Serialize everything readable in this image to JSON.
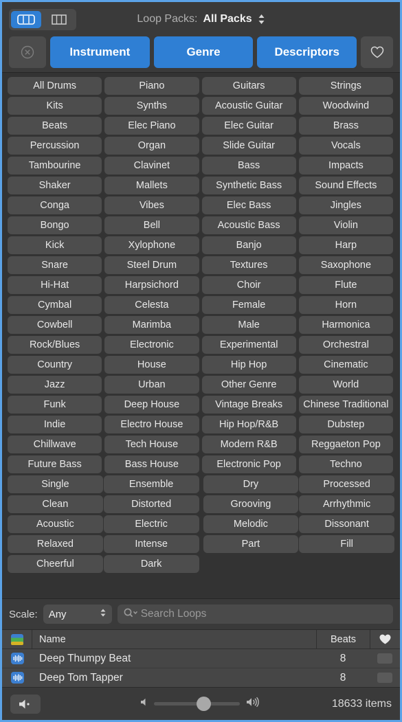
{
  "colors": {
    "accent": "#2f7fd4",
    "window_border": "#5ba3e8",
    "chrome_bg": "#3a3a3a",
    "grid_bg": "#333333",
    "tag_bg": "#4d4d4d",
    "list_bg": "#464646"
  },
  "topbar": {
    "view_mode_buttons": [
      {
        "name": "list-view",
        "icon": "columns-rounded-icon",
        "active": true
      },
      {
        "name": "column-view",
        "icon": "columns-square-icon",
        "active": false
      }
    ],
    "loop_packs_label": "Loop Packs:",
    "loop_packs_value": "All Packs",
    "stepper_icon": "chevron-up-down-icon"
  },
  "categories": {
    "clear_icon": "circle-x-icon",
    "buttons": [
      {
        "label": "Instrument",
        "active": true
      },
      {
        "label": "Genre",
        "active": true
      },
      {
        "label": "Descriptors",
        "active": true
      }
    ],
    "favorites_icon": "heart-outline-icon"
  },
  "tag_grid": {
    "rows": [
      {
        "style": "wide",
        "cells": [
          "All Drums",
          "Piano",
          "Guitars",
          "Strings"
        ]
      },
      {
        "style": "wide",
        "cells": [
          "Kits",
          "Synths",
          "Acoustic Guitar",
          "Woodwind"
        ]
      },
      {
        "style": "wide",
        "cells": [
          "Beats",
          "Elec Piano",
          "Elec Guitar",
          "Brass"
        ]
      },
      {
        "style": "wide",
        "cells": [
          "Percussion",
          "Organ",
          "Slide Guitar",
          "Vocals"
        ]
      },
      {
        "style": "wide",
        "cells": [
          "Tambourine",
          "Clavinet",
          "Bass",
          "Impacts"
        ]
      },
      {
        "style": "wide",
        "cells": [
          "Shaker",
          "Mallets",
          "Synthetic Bass",
          "Sound Effects"
        ]
      },
      {
        "style": "wide",
        "cells": [
          "Conga",
          "Vibes",
          "Elec Bass",
          "Jingles"
        ]
      },
      {
        "style": "wide",
        "cells": [
          "Bongo",
          "Bell",
          "Acoustic Bass",
          "Violin"
        ]
      },
      {
        "style": "wide",
        "cells": [
          "Kick",
          "Xylophone",
          "Banjo",
          "Harp"
        ]
      },
      {
        "style": "wide",
        "cells": [
          "Snare",
          "Steel Drum",
          "Textures",
          "Saxophone"
        ]
      },
      {
        "style": "wide",
        "cells": [
          "Hi-Hat",
          "Harpsichord",
          "Choir",
          "Flute"
        ]
      },
      {
        "style": "wide",
        "cells": [
          "Cymbal",
          "Celesta",
          "Female",
          "Horn"
        ]
      },
      {
        "style": "wide",
        "cells": [
          "Cowbell",
          "Marimba",
          "Male",
          "Harmonica"
        ]
      },
      {
        "style": "wide",
        "cells": [
          "Rock/Blues",
          "Electronic",
          "Experimental",
          "Orchestral"
        ]
      },
      {
        "style": "wide",
        "cells": [
          "Country",
          "House",
          "Hip Hop",
          "Cinematic"
        ]
      },
      {
        "style": "wide",
        "cells": [
          "Jazz",
          "Urban",
          "Other Genre",
          "World"
        ]
      },
      {
        "style": "wide",
        "cells": [
          "Funk",
          "Deep House",
          "Vintage Breaks",
          "Chinese Traditional"
        ]
      },
      {
        "style": "wide",
        "cells": [
          "Indie",
          "Electro House",
          "Hip Hop/R&B",
          "Dubstep"
        ]
      },
      {
        "style": "wide",
        "cells": [
          "Chillwave",
          "Tech House",
          "Modern R&B",
          "Reggaeton Pop"
        ]
      },
      {
        "style": "wide",
        "cells": [
          "Future Bass",
          "Bass House",
          "Electronic Pop",
          "Techno"
        ]
      },
      {
        "style": "pairs",
        "cells": [
          "Single",
          "Ensemble",
          "Dry",
          "Processed"
        ]
      },
      {
        "style": "pairs",
        "cells": [
          "Clean",
          "Distorted",
          "Grooving",
          "Arrhythmic"
        ]
      },
      {
        "style": "pairs",
        "cells": [
          "Acoustic",
          "Electric",
          "Melodic",
          "Dissonant"
        ]
      },
      {
        "style": "pairs",
        "cells": [
          "Relaxed",
          "Intense",
          "Part",
          "Fill"
        ]
      },
      {
        "style": "pairs",
        "cells": [
          "Cheerful",
          "Dark",
          "",
          ""
        ]
      }
    ]
  },
  "searchbar": {
    "scale_label": "Scale:",
    "scale_value": "Any",
    "scale_stepper_icon": "chevron-up-down-icon",
    "search_icon": "search-icon",
    "search_value": "",
    "search_placeholder": "Search Loops"
  },
  "results": {
    "header_icon": "color-stripes-icon",
    "col_name": "Name",
    "col_beats": "Beats",
    "col_favorite_icon": "heart-filled-icon",
    "rows": [
      {
        "icon": "waveform-icon",
        "name": "Deep Thumpy Beat",
        "beats": "8"
      },
      {
        "icon": "waveform-icon",
        "name": "Deep Tom Tapper",
        "beats": "8"
      }
    ]
  },
  "bottombar": {
    "mute_icon": "speaker-mute-icon",
    "volume_low_icon": "speaker-low-icon",
    "volume_high_icon": "speaker-high-icon",
    "items_count": "18633 items"
  }
}
